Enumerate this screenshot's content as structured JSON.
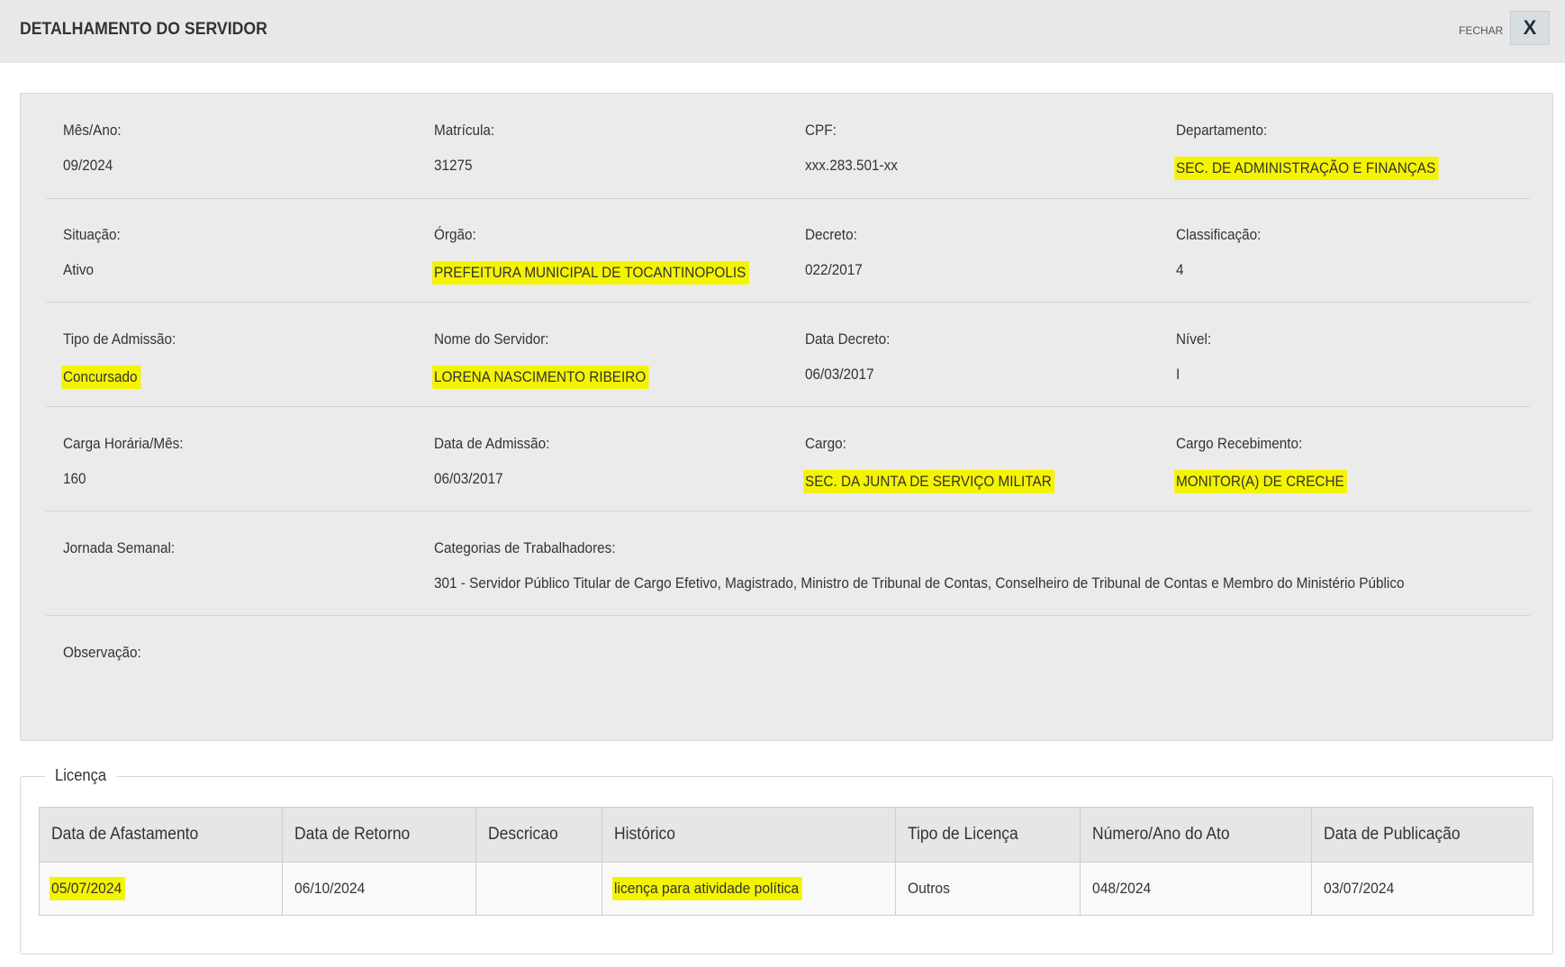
{
  "modal": {
    "title": "DETALHAMENTO DO SERVIDOR",
    "close_label": "FECHAR",
    "close_icon": "X"
  },
  "details": {
    "mes_ano": {
      "label": "Mês/Ano:",
      "value": "09/2024"
    },
    "matricula": {
      "label": "Matrícula:",
      "value": "31275"
    },
    "cpf": {
      "label": "CPF:",
      "value": "xxx.283.501-xx"
    },
    "departamento": {
      "label": "Departamento:",
      "value": "SEC. DE ADMINISTRAÇÃO E FINANÇAS"
    },
    "situacao": {
      "label": "Situação:",
      "value": "Ativo"
    },
    "orgao": {
      "label": "Órgão:",
      "value": "PREFEITURA MUNICIPAL DE TOCANTINOPOLIS"
    },
    "decreto": {
      "label": "Decreto:",
      "value": "022/2017"
    },
    "classificacao": {
      "label": "Classificação:",
      "value": "4"
    },
    "tipo_admissao": {
      "label": "Tipo de Admissão:",
      "value": "Concursado"
    },
    "nome_servidor": {
      "label": "Nome do Servidor:",
      "value": "LORENA NASCIMENTO RIBEIRO"
    },
    "data_decreto": {
      "label": "Data Decreto:",
      "value": "06/03/2017"
    },
    "nivel": {
      "label": "Nível:",
      "value": "I"
    },
    "carga_horaria": {
      "label": "Carga Horária/Mês:",
      "value": "160"
    },
    "data_admissao": {
      "label": "Data de Admissão:",
      "value": "06/03/2017"
    },
    "cargo": {
      "label": "Cargo:",
      "value": "SEC. DA JUNTA DE SERVIÇO MILITAR"
    },
    "cargo_recebimento": {
      "label": "Cargo Recebimento:",
      "value": "MONITOR(A) DE CRECHE"
    },
    "jornada_semanal": {
      "label": "Jornada Semanal:",
      "value": ""
    },
    "categorias": {
      "label": "Categorias de Trabalhadores:",
      "value": "301 - Servidor Público Titular de Cargo Efetivo, Magistrado, Ministro de Tribunal de Contas, Conselheiro de Tribunal de Contas e Membro do Ministério Público"
    },
    "observacao": {
      "label": "Observação:",
      "value": ""
    }
  },
  "licenca": {
    "legend": "Licença",
    "columns": [
      "Data de Afastamento",
      "Data de Retorno",
      "Descricao",
      "Histórico",
      "Tipo de Licença",
      "Número/Ano do Ato",
      "Data de Publicação"
    ],
    "rows": [
      [
        "05/07/2024",
        "06/10/2024",
        "",
        "licença para atividade política",
        "Outros",
        "048/2024",
        "03/07/2024"
      ]
    ]
  },
  "colors": {
    "highlight": "#f4f400",
    "panel_bg": "#ebebeb",
    "header_bg": "#e8e8e8"
  }
}
